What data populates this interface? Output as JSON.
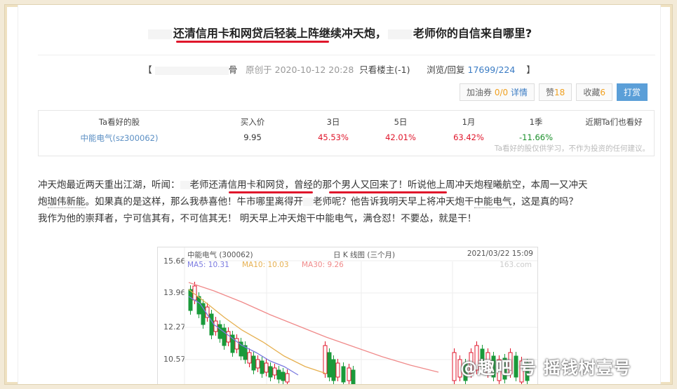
{
  "post": {
    "title_main": "还清信用卡和网贷后轻装上阵继续冲天炮，",
    "title_tail": "老师你的自信来自哪里?",
    "bracket_left": "【",
    "author_tail": "骨",
    "created_label": "原创于 2020-10-12 20:28",
    "only_op": "只看楼主(-1)",
    "views_label": "浏览/回复",
    "views": "17699",
    "slash": "/",
    "replies": "224",
    "bracket_right": "】"
  },
  "actions": {
    "fuel_label": "加油券",
    "fuel_value": "0/0",
    "fuel_detail": "详情",
    "like_label": "赞",
    "like_count": "18",
    "fav_label": "收藏",
    "fav_count": "6",
    "reward_label": "打赏"
  },
  "stock_table": {
    "headers": [
      "Ta看好的股",
      "买入价",
      "3日",
      "5日",
      "1月",
      "1季",
      "近期Ta们也看好"
    ],
    "stock": "中能电气(sz300062)",
    "buy_price": "9.95",
    "d3": "45.53%",
    "d5": "42.01%",
    "m1": "63.42%",
    "q1": "-11.66%",
    "disclaimer": "Ta看好的股仅供学习，不作为投资的任何建议。"
  },
  "content": {
    "l1a": "冲天炮最近两天重出江湖，听闻：",
    "l1b": "老师",
    "l1c": "还清信用卡和网贷",
    "l1d": "，",
    "l1e": "曾经的那个男人又回来了！",
    "l1f": "听说他上周冲天炮程曦航空，本周一又冲天",
    "l2a": "炮",
    "l2b": "珈伟新能",
    "l2c": "。如果真的是这样，那么我恭喜他！牛市哪里离得开",
    "l2d": "老师呢？他告诉我明天早上将冲天炮干",
    "l2e": "中能电气",
    "l2f": "，这是真的吗？",
    "l3": "我作为他的崇拜者，宁可信其有，不可信其无！ 明天早上冲天炮干中能电气，满仓怼！不要怂，就是干！"
  },
  "chart": {
    "name": "中能电气 (300062)",
    "type": "日 K 线图 (三个月)",
    "date": "2021/03/22 15:09",
    "source": "163.com",
    "ma5": "MA5: 10.31",
    "ma10": "MA10: 10.03",
    "ma30": "MA30: 9.26",
    "yticks": [
      "15.66",
      "13.96",
      "12.27",
      "10.57"
    ],
    "colors": {
      "up": "#e0162b",
      "down": "#1a9a3a",
      "ma5": "#7b7be0",
      "ma10": "#e6b050",
      "ma30": "#f08a8a"
    }
  },
  "watermark": "@趣吧 号 摇钱树壹号"
}
